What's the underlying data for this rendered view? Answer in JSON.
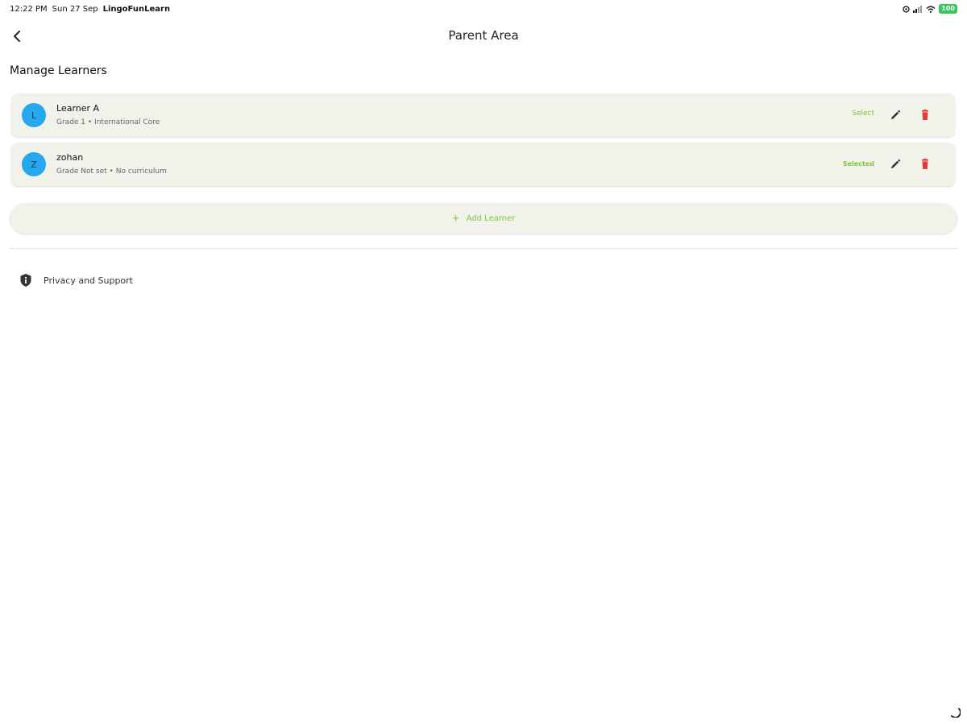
{
  "status_bar": {
    "time": "12:22 PM",
    "date": "Sun 27 Sep",
    "app_name": "LingoFunLearn",
    "battery": "100"
  },
  "nav": {
    "back_icon": "chevron-left-icon",
    "title": "Parent Area"
  },
  "section_title": "Manage Learners",
  "learners": [
    {
      "initial": "L",
      "name": "Learner A",
      "subtitle": "Grade 1 • International Core",
      "select_label": "Select",
      "selected": false
    },
    {
      "initial": "Z",
      "name": "zohan",
      "subtitle": "Grade Not set • No curriculum",
      "select_label": "Selected",
      "selected": true
    }
  ],
  "add_learner": {
    "icon": "+",
    "label": "Add Learner"
  },
  "privacy": {
    "icon": "shield-info-icon",
    "label": "Privacy and Support"
  },
  "colors": {
    "accent": "#7ec63d",
    "card_bg": "#f1f2ea",
    "avatar_bg": "#27a7ee",
    "delete": "#e53935"
  }
}
